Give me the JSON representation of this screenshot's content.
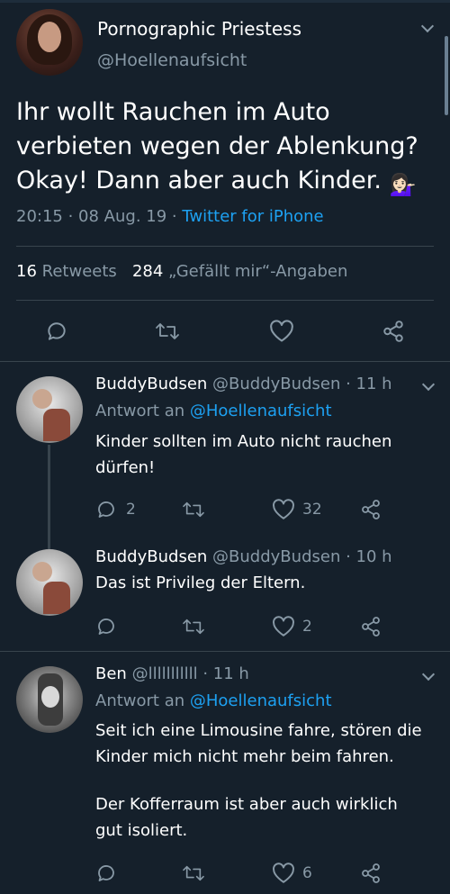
{
  "main_tweet": {
    "display_name": "Pornographic Priestess",
    "handle": "@Hoellenaufsicht",
    "text": "Ihr wollt Rauchen im Auto verbieten wegen der Ablenkung? Okay! Dann aber auch Kinder.",
    "emoji": "💁🏻‍♀️",
    "time": "20:15",
    "date": "08 Aug. 19",
    "source": "Twitter for iPhone",
    "retweet_count": "16",
    "retweet_label": "Retweets",
    "like_count": "284",
    "like_label": "„Gefällt mir“-Angaben"
  },
  "replies": [
    {
      "display_name": "BuddyBudsen",
      "handle": "@BuddyBudsen",
      "time": "11 h",
      "reply_to_label": "Antwort an",
      "reply_to_handle": "@Hoellenaufsicht",
      "text": "Kinder sollten im Auto nicht rauchen dürfen!",
      "reply_count": "2",
      "like_count": "32"
    },
    {
      "display_name": "BuddyBudsen",
      "handle": "@BuddyBudsen",
      "time": "10 h",
      "text": "Das ist Privileg der Eltern.",
      "reply_count": "",
      "like_count": "2"
    },
    {
      "display_name": "Ben",
      "handle": "@lllllllllll",
      "time": "11 h",
      "reply_to_label": "Antwort an",
      "reply_to_handle": "@Hoellenaufsicht",
      "text_p1": "Seit ich eine Limousine fahre, stören die Kinder mich nicht mehr beim fahren.",
      "text_p2": "Der Kofferraum ist aber auch wirklich gut isoliert.",
      "reply_count": "",
      "like_count": "6"
    }
  ],
  "icons": {
    "reply": "reply-icon",
    "retweet": "retweet-icon",
    "like": "heart-icon",
    "share": "share-icon",
    "menu": "chevron-down-icon"
  },
  "colors": {
    "background": "#15202b",
    "accent": "#1da1f2",
    "secondary_text": "#8899a6",
    "divider": "#38444d"
  },
  "separators": {
    "dot": " · "
  }
}
